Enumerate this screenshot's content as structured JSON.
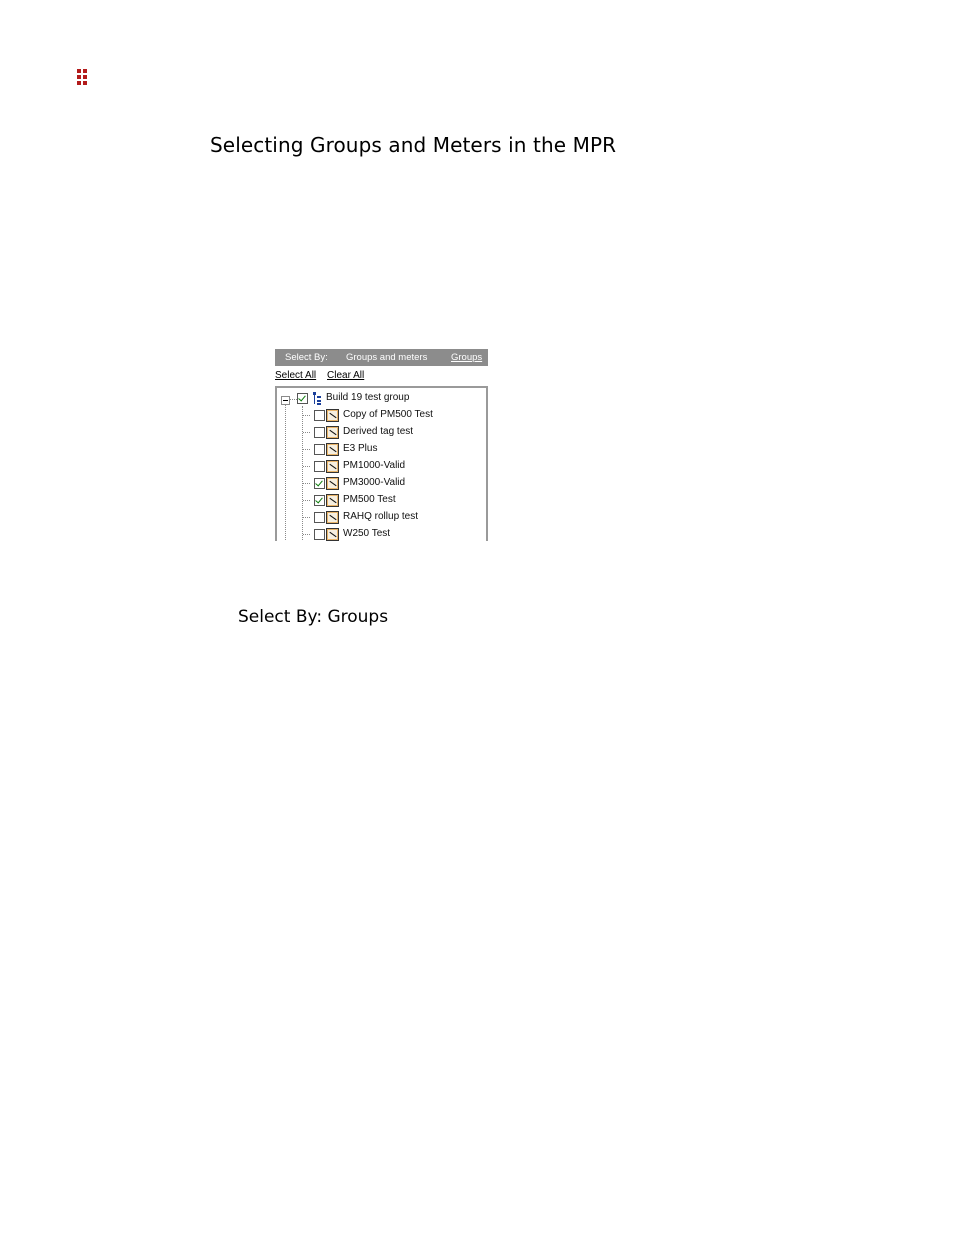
{
  "document": {
    "heading": "Selecting Groups and Meters in the MPR",
    "subheading": "Select By: Groups"
  },
  "widget": {
    "select_by_label": "Select By:",
    "options": [
      "Groups and meters",
      "Groups"
    ],
    "active_option": "Groups",
    "select_all_label": "Select All",
    "clear_all_label": "Clear All",
    "tree": {
      "group": {
        "label": "Build 19 test group",
        "checked": true,
        "expanded": true
      },
      "meters": [
        {
          "label": "Copy of PM500 Test",
          "checked": false
        },
        {
          "label": "Derived tag test",
          "checked": false
        },
        {
          "label": "E3 Plus",
          "checked": false
        },
        {
          "label": "PM1000-Valid",
          "checked": false
        },
        {
          "label": "PM3000-Valid",
          "checked": true
        },
        {
          "label": "PM500 Test",
          "checked": true
        },
        {
          "label": "RAHQ rollup test",
          "checked": false
        },
        {
          "label": "W250 Test",
          "checked": false
        }
      ]
    }
  },
  "colors": {
    "logo": "#b31b1b",
    "header_bar": "#8c8c8c",
    "group_icon": "#1a3f9a",
    "meter_icon": "#e8b46a",
    "checkmark": "#0a7a0a"
  }
}
